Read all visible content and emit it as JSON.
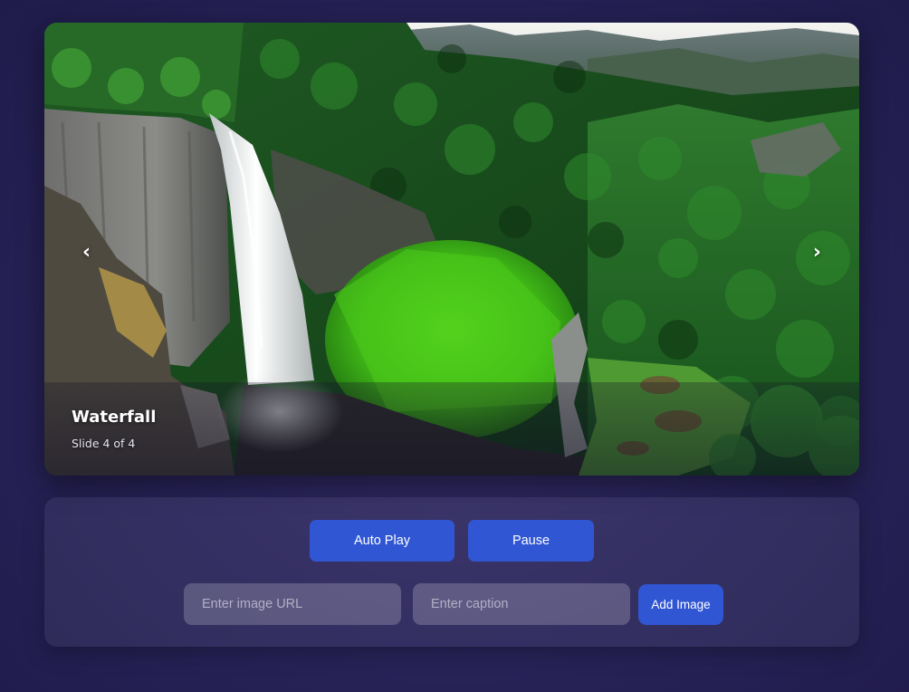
{
  "slider": {
    "prev_arrow": "‹",
    "next_arrow": "›",
    "current_slide": {
      "title": "Waterfall",
      "counter": "Slide 4 of 4"
    }
  },
  "controls": {
    "autoplay_label": "Auto Play",
    "pause_label": "Pause",
    "url_placeholder": "Enter image URL",
    "url_value": "",
    "caption_placeholder": "Enter caption",
    "caption_value": "",
    "add_label": "Add Image"
  },
  "colors": {
    "accent": "#3056d3",
    "background": "#29245a"
  },
  "icons": {
    "prev": "chevron-left-icon",
    "next": "chevron-right-icon"
  }
}
